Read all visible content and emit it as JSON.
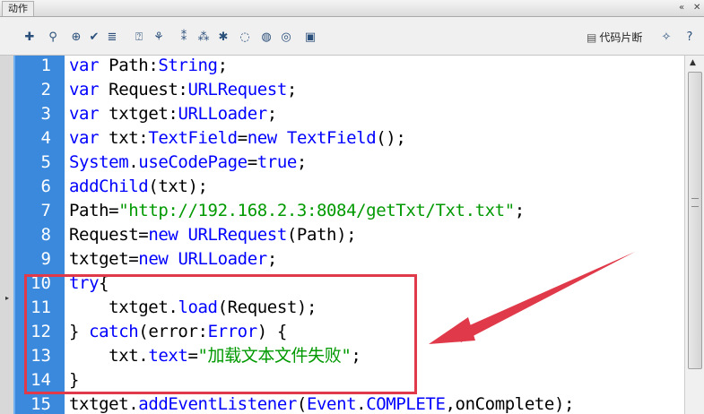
{
  "window": {
    "title": "动作"
  },
  "toolbar": {
    "icons": [
      "add-statement-icon",
      "find-icon",
      "target-icon",
      "check-syntax-icon",
      "auto-format-icon",
      "code-hint-icon",
      "debug-options-icon",
      "collapse-braces-icon",
      "collapse-selection-icon",
      "expand-all-icon",
      "apply-block-comment-icon",
      "apply-line-comment-icon",
      "remove-comment-icon",
      "show-hide-toolbox-icon"
    ],
    "snippets_label": "代码片断"
  },
  "editor": {
    "lines": [
      {
        "n": "1",
        "tokens": [
          {
            "t": "var",
            "c": "kw"
          },
          {
            "t": " Path:"
          },
          {
            "t": "String",
            "c": "ty"
          },
          {
            "t": ";"
          }
        ]
      },
      {
        "n": "2",
        "tokens": [
          {
            "t": "var",
            "c": "kw"
          },
          {
            "t": " Request:"
          },
          {
            "t": "URLRequest",
            "c": "ty"
          },
          {
            "t": ";"
          }
        ]
      },
      {
        "n": "3",
        "tokens": [
          {
            "t": "var",
            "c": "kw"
          },
          {
            "t": " txtget:"
          },
          {
            "t": "URLLoader",
            "c": "ty"
          },
          {
            "t": ";"
          }
        ]
      },
      {
        "n": "4",
        "tokens": [
          {
            "t": "var",
            "c": "kw"
          },
          {
            "t": " txt:"
          },
          {
            "t": "TextField",
            "c": "ty"
          },
          {
            "t": "="
          },
          {
            "t": "new",
            "c": "kw"
          },
          {
            "t": " "
          },
          {
            "t": "TextField",
            "c": "ty"
          },
          {
            "t": "();"
          }
        ]
      },
      {
        "n": "5",
        "tokens": [
          {
            "t": "System",
            "c": "ty"
          },
          {
            "t": "."
          },
          {
            "t": "useCodePage",
            "c": "ty"
          },
          {
            "t": "="
          },
          {
            "t": "true",
            "c": "kw"
          },
          {
            "t": ";"
          }
        ]
      },
      {
        "n": "6",
        "tokens": [
          {
            "t": "addChild",
            "c": "ty"
          },
          {
            "t": "(txt);"
          }
        ]
      },
      {
        "n": "7",
        "tokens": [
          {
            "t": "Path="
          },
          {
            "t": "\"http://192.168.2.3:8084/getTxt/Txt.txt\"",
            "c": "str"
          },
          {
            "t": ";"
          }
        ]
      },
      {
        "n": "8",
        "tokens": [
          {
            "t": "Request="
          },
          {
            "t": "new",
            "c": "kw"
          },
          {
            "t": " "
          },
          {
            "t": "URLRequest",
            "c": "ty"
          },
          {
            "t": "(Path);"
          }
        ]
      },
      {
        "n": "9",
        "tokens": [
          {
            "t": "txtget="
          },
          {
            "t": "new",
            "c": "kw"
          },
          {
            "t": " "
          },
          {
            "t": "URLLoader",
            "c": "ty"
          },
          {
            "t": ";"
          }
        ]
      },
      {
        "n": "10",
        "tokens": [
          {
            "t": "try",
            "c": "kw"
          },
          {
            "t": "{"
          }
        ]
      },
      {
        "n": "11",
        "tokens": [
          {
            "t": "    txtget."
          },
          {
            "t": "load",
            "c": "ty"
          },
          {
            "t": "(Request);"
          }
        ]
      },
      {
        "n": "12",
        "tokens": [
          {
            "t": "} "
          },
          {
            "t": "catch",
            "c": "kw"
          },
          {
            "t": "(error:"
          },
          {
            "t": "Error",
            "c": "ty"
          },
          {
            "t": ") {"
          }
        ]
      },
      {
        "n": "13",
        "tokens": [
          {
            "t": "    txt."
          },
          {
            "t": "text",
            "c": "ty"
          },
          {
            "t": "="
          },
          {
            "t": "\"加载文本文件失败\"",
            "c": "str"
          },
          {
            "t": ";"
          }
        ]
      },
      {
        "n": "14",
        "tokens": [
          {
            "t": "}"
          }
        ]
      },
      {
        "n": "15",
        "tokens": [
          {
            "t": "txtget."
          },
          {
            "t": "addEventListener",
            "c": "ty"
          },
          {
            "t": "("
          },
          {
            "t": "Event",
            "c": "ty"
          },
          {
            "t": "."
          },
          {
            "t": "COMPLETE",
            "c": "ty"
          },
          {
            "t": ",onComplete);"
          }
        ]
      }
    ]
  },
  "colors": {
    "gutter": "#3b89dd",
    "keyword": "#0000ff",
    "string": "#009900",
    "highlight": "#e03a4a"
  }
}
